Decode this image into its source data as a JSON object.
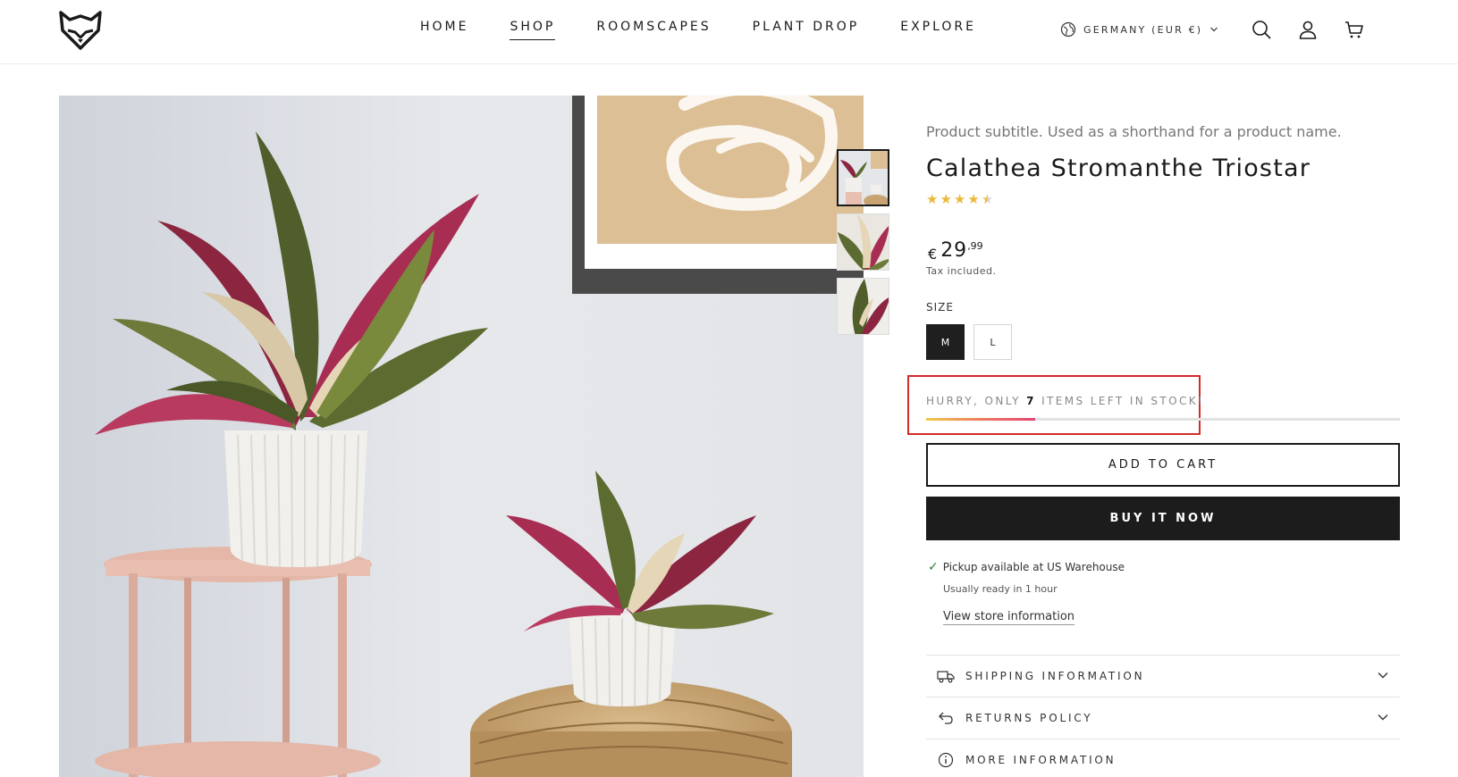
{
  "header": {
    "nav": [
      "HOME",
      "SHOP",
      "ROOMSCAPES",
      "PLANT DROP",
      "EXPLORE"
    ],
    "active_nav": "SHOP",
    "locale": "GERMANY (EUR €)"
  },
  "product": {
    "subtitle": "Product subtitle. Used as a shorthand for a product name.",
    "title": "Calathea Stromanthe Triostar",
    "rating": 4.5,
    "rating_max": 5,
    "price": {
      "currency": "€",
      "main": "29",
      "cents": ",99"
    },
    "tax_note": "Tax included.",
    "size_label": "SIZE",
    "sizes": [
      "M",
      "L"
    ],
    "selected_size": "M",
    "stock": {
      "prefix": "HURRY, ONLY ",
      "count": "7",
      "suffix": " ITEMS LEFT IN STOCK!",
      "level": 0.23
    },
    "add_to_cart": "ADD TO CART",
    "buy_now": "BUY IT NOW",
    "pickup": {
      "text": "Pickup available at US Warehouse",
      "ready": "Usually ready in 1 hour",
      "link": "View store information"
    },
    "accordion": [
      {
        "label": "SHIPPING INFORMATION",
        "icon": "truck-icon"
      },
      {
        "label": "RETURNS POLICY",
        "icon": "return-arrow-icon"
      },
      {
        "label": "MORE INFORMATION",
        "icon": "info-icon"
      }
    ]
  },
  "colors": {
    "accent_dark": "#1c1c1c",
    "star": "#e9b93a",
    "highlight_box": "#d42b2b",
    "check": "#2e7d32"
  }
}
